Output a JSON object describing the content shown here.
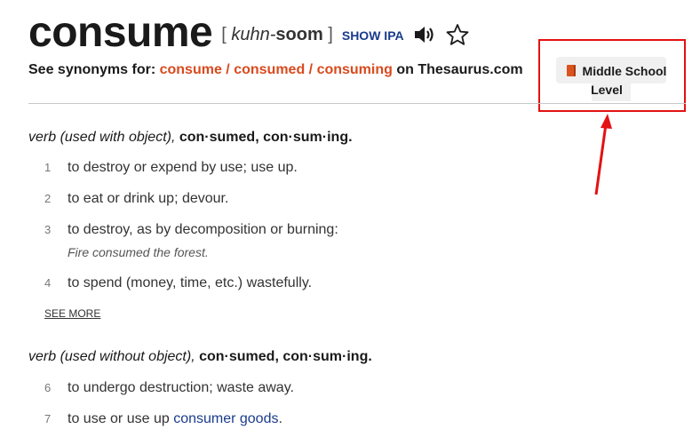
{
  "entry": {
    "headword": "consume",
    "pron_open": "[",
    "pron_light": "kuhn-",
    "pron_stress": "soom",
    "pron_close": "]",
    "show_ipa": "SHOW IPA",
    "icons": {
      "audio": "speaker-icon",
      "favorite": "star-outline-icon"
    }
  },
  "synonyms": {
    "prefix": "See synonyms for:",
    "links": [
      "consume",
      "consumed",
      "consuming"
    ],
    "separator": " / ",
    "suffix": "on Thesaurus.com"
  },
  "level_badge": {
    "line1": "Middle School",
    "line2": "Level",
    "icon": "book-icon",
    "color": "#d9541e"
  },
  "annotation": {
    "box_color": "#e31212"
  },
  "sections": [
    {
      "pos": "verb (used with object),",
      "inflections": "con·sumed, con·sum·ing.",
      "definitions": [
        {
          "num": "1",
          "text": "to destroy or expend by use; use up."
        },
        {
          "num": "2",
          "text": "to eat or drink up; devour."
        },
        {
          "num": "3",
          "text": "to destroy, as by decomposition or burning:",
          "example": "Fire consumed the forest."
        },
        {
          "num": "4",
          "text": "to spend (money, time, etc.) wastefully."
        }
      ],
      "see_more": "SEE MORE"
    },
    {
      "pos": "verb (used without object),",
      "inflections": "con·sumed, con·sum·ing.",
      "definitions": [
        {
          "num": "6",
          "text": "to undergo destruction; waste away."
        },
        {
          "num": "7",
          "text": "to use or use up ",
          "link": "consumer goods",
          "after": "."
        }
      ]
    }
  ]
}
